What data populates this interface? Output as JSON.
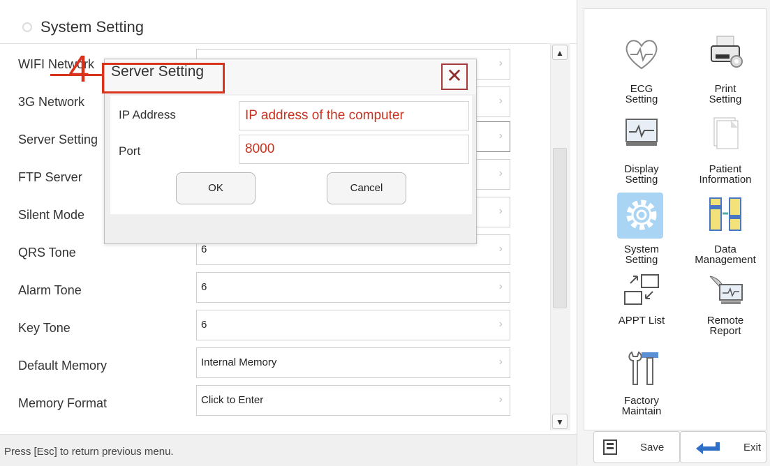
{
  "header": {
    "title": "System Setting"
  },
  "settings": {
    "labels": [
      "WIFI Network",
      "3G Network",
      "Server Setting",
      "FTP Server",
      "Silent Mode",
      "QRS Tone",
      "Alarm Tone",
      "Key Tone",
      "Default Memory",
      "Memory Format"
    ],
    "values": [
      "",
      "",
      "",
      "",
      "",
      "6",
      "6",
      "6",
      "Internal Memory",
      "Click to Enter"
    ]
  },
  "dialog": {
    "title": "Server Setting",
    "ip_label": "IP Address",
    "ip_value": "IP address of the computer",
    "port_label": "Port",
    "port_value": "8000",
    "ok_label": "OK",
    "cancel_label": "Cancel",
    "close_glyph": "✕"
  },
  "annotation": {
    "step_number": "4",
    "color": "#d9331d"
  },
  "status_bar": {
    "text": "Press [Esc] to return previous menu."
  },
  "scrollbar": {
    "up_glyph": "▲",
    "down_glyph": "▼"
  },
  "menu": {
    "tiles": [
      {
        "label": "ECG\nSetting",
        "icon": "heart-ecg-icon"
      },
      {
        "label": "Print\nSetting",
        "icon": "printer-gear-icon"
      },
      {
        "label": "Display\nSetting",
        "icon": "monitor-icon"
      },
      {
        "label": "Patient\nInformation",
        "icon": "documents-icon"
      },
      {
        "label": "System\nSetting",
        "icon": "gear-icon",
        "active": true
      },
      {
        "label": "Data\nManagement",
        "icon": "data-transfer-icon"
      },
      {
        "label": "APPT List",
        "icon": "appointment-list-icon"
      },
      {
        "label": "Remote\nReport",
        "icon": "satellite-monitor-icon"
      },
      {
        "label": "Factory\nMaintain",
        "icon": "wrench-hammer-icon"
      }
    ]
  },
  "bottom_bar": {
    "save_label": "Save",
    "exit_label": "Exit"
  },
  "colors": {
    "accent_red": "#d9331d",
    "active_tile": "#a9d4f4",
    "dialog_text_red": "#c8331f"
  }
}
